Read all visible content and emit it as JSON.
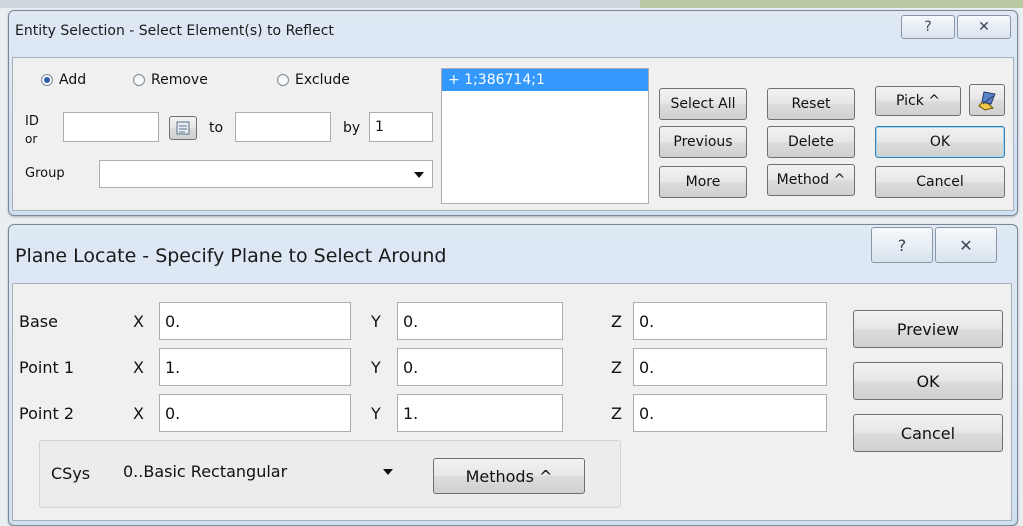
{
  "entity_dialog": {
    "title": "Entity Selection - Select Element(s) to Reflect",
    "help_glyph": "?",
    "close_glyph": "✕",
    "radio_add": "Add",
    "radio_remove": "Remove",
    "radio_exclude": "Exclude",
    "selected_mode": "Add",
    "id_label": "ID",
    "or_label": "or",
    "group_label": "Group",
    "id_from_value": "",
    "to_label": "to",
    "id_to_value": "",
    "by_label": "by",
    "by_value": "1",
    "group_value": "",
    "list_items": [
      "+ 1;386714;1"
    ],
    "buttons": {
      "select_all": "Select All",
      "reset": "Reset",
      "pick": "Pick ^",
      "previous": "Previous",
      "delete": "Delete",
      "ok": "OK",
      "more": "More",
      "method": "Method ^",
      "cancel": "Cancel"
    }
  },
  "plane_dialog": {
    "title": "Plane Locate - Specify Plane to Select Around",
    "help_glyph": "?",
    "close_glyph": "✕",
    "rows": [
      {
        "label": "Base",
        "x": "0.",
        "y": "0.",
        "z": "0."
      },
      {
        "label": "Point 1",
        "x": "1.",
        "y": "0.",
        "z": "0."
      },
      {
        "label": "Point 2",
        "x": "0.",
        "y": "1.",
        "z": "0."
      }
    ],
    "x_label": "X",
    "y_label": "Y",
    "z_label": "Z",
    "csys_label": "CSys",
    "csys_value": "0..Basic Rectangular",
    "methods_button": "Methods ^",
    "preview_button": "Preview",
    "ok_button": "OK",
    "cancel_button": "Cancel"
  }
}
